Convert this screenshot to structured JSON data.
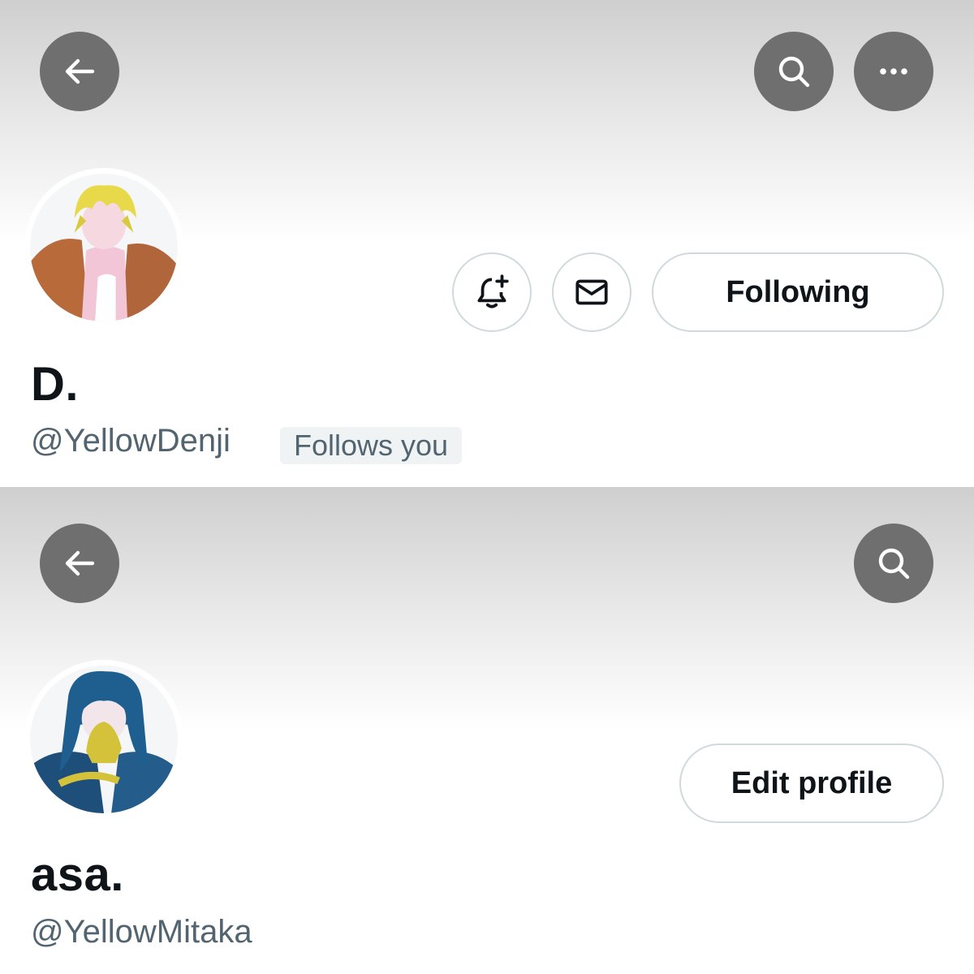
{
  "profiles": [
    {
      "display_name": "D.",
      "handle": "@YellowDenji",
      "follows_you_badge": "Follows you",
      "follow_button_label": "Following",
      "header_buttons": [
        "back-arrow-icon",
        "search-icon",
        "more-dots-icon"
      ],
      "action_icons": [
        "bell-plus-icon",
        "envelope-icon"
      ],
      "avatar_colors": {
        "hair": "#e8d94a",
        "jacket": "#b86a3a",
        "skin": "#f2c6d6"
      }
    },
    {
      "display_name": "asa.",
      "handle": "@YellowMitaka",
      "edit_button_label": "Edit profile",
      "header_buttons": [
        "back-arrow-icon",
        "search-icon"
      ],
      "avatar_colors": {
        "hair": "#1f5f8f",
        "hand": "#d4c23a",
        "coat": "#1e4f7a"
      }
    }
  ],
  "colors": {
    "header_button_bg": "#6f6f6f",
    "button_border": "#cfd9de",
    "secondary_text": "#536471",
    "badge_bg": "#eff3f4",
    "primary_text": "#0f1419"
  }
}
